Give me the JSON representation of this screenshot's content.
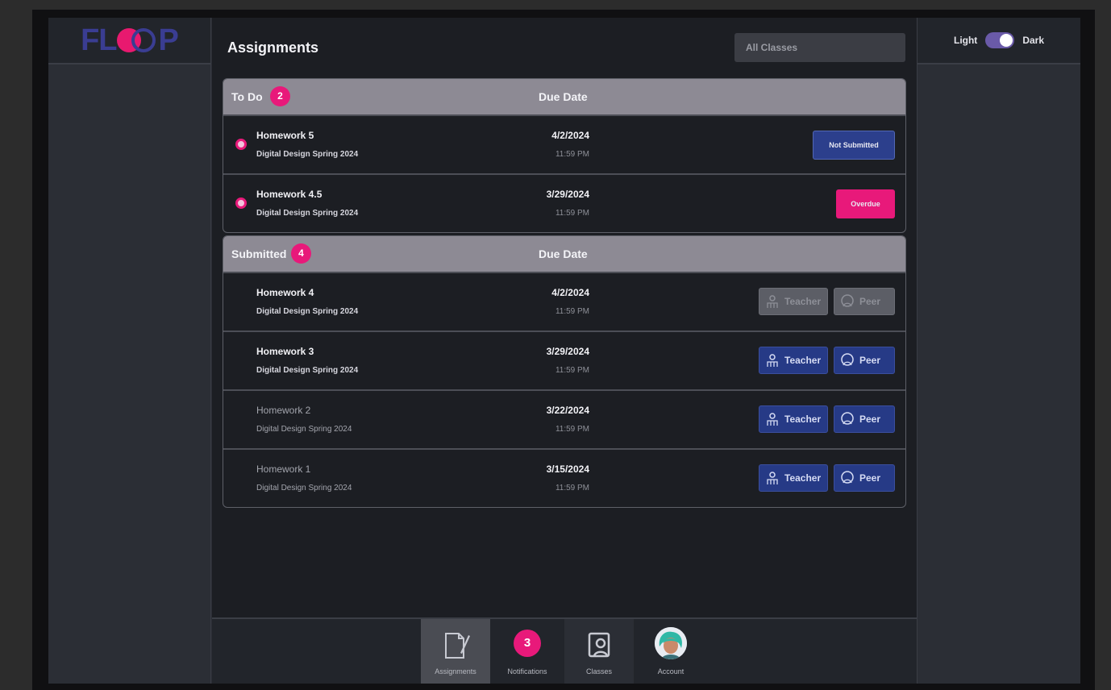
{
  "app": {
    "logo_text": "FLOOP"
  },
  "theme": {
    "light_label": "Light",
    "dark_label": "Dark",
    "mode": "dark"
  },
  "header": {
    "title": "Assignments",
    "class_filter": "All Classes"
  },
  "todo": {
    "title": "To Do",
    "count": "2",
    "due_header": "Due Date",
    "rows": [
      {
        "title": "Homework 5",
        "class": "Digital Design Spring 2024",
        "date": "4/2/2024",
        "time": "11:59 PM",
        "status": "Not Submitted"
      },
      {
        "title": "Homework 4.5",
        "class": "Digital Design Spring 2024",
        "date": "3/29/2024",
        "time": "11:59 PM",
        "status": "Overdue"
      }
    ]
  },
  "submitted": {
    "title": "Submitted",
    "count": "4",
    "due_header": "Due Date",
    "rows": [
      {
        "title": "Homework 4",
        "class": "Digital Design Spring 2024",
        "date": "4/2/2024",
        "time": "11:59 PM",
        "teacher": "Teacher",
        "peer": "Peer",
        "feedback_available": false
      },
      {
        "title": "Homework 3",
        "class": "Digital Design Spring 2024",
        "date": "3/29/2024",
        "time": "11:59 PM",
        "teacher": "Teacher",
        "peer": "Peer",
        "feedback_available": true
      },
      {
        "title": "Homework 2",
        "class": "Digital Design Spring 2024",
        "date": "3/22/2024",
        "time": "11:59 PM",
        "teacher": "Teacher",
        "peer": "Peer",
        "feedback_available": true
      },
      {
        "title": "Homework 1",
        "class": "Digital Design Spring 2024",
        "date": "3/15/2024",
        "time": "11:59 PM",
        "teacher": "Teacher",
        "peer": "Peer",
        "feedback_available": true
      }
    ]
  },
  "nav": {
    "assignments": "Assignments",
    "notifications": "Notifications",
    "notifications_count": "3",
    "classes": "Classes",
    "account": "Account"
  },
  "colors": {
    "accent": "#e8197a",
    "primary": "#263a86",
    "header_gray": "#8d8a94"
  }
}
